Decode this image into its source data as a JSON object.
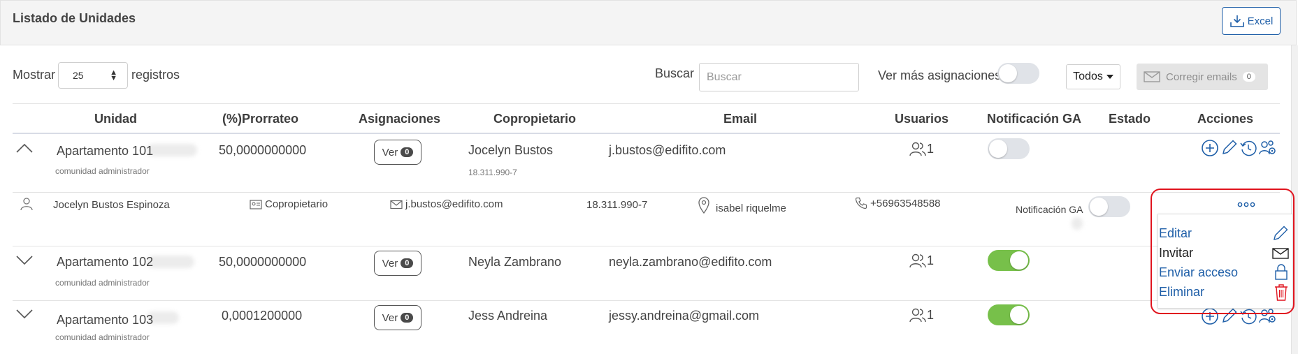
{
  "header": {
    "title": "Listado de Unidades",
    "excel_label": "Excel"
  },
  "controls": {
    "show_label": "Mostrar",
    "page_size": "25",
    "records_label": "registros",
    "search_label": "Buscar",
    "search_placeholder": "Buscar",
    "more_assign_label": "Ver más asignaciones",
    "filter_label": "Todos",
    "fix_emails_label": "Corregir emails",
    "fix_emails_count": "0"
  },
  "table": {
    "columns": [
      "Unidad",
      "(%)Prorrateo",
      "Asignaciones",
      "Copropietario",
      "Email",
      "Usuarios",
      "Notificación GA",
      "Estado",
      "Acciones"
    ],
    "rows": [
      {
        "unit": "Apartamento 101",
        "unit_sub": "comunidad administrador",
        "prorrateo": "50,0000000000",
        "ver_label": "Ver",
        "ver_count": "0",
        "owner": "Jocelyn Bustos",
        "owner_rut": "18.311.990-7",
        "email": "j.bustos@edifito.com",
        "users": "1",
        "notif_on": false
      },
      {
        "unit": "Apartamento 102",
        "unit_sub": "comunidad administrador",
        "prorrateo": "50,0000000000",
        "ver_label": "Ver",
        "ver_count": "0",
        "owner": "Neyla Zambrano",
        "owner_rut": "",
        "email": "neyla.zambrano@edifito.com",
        "users": "1",
        "notif_on": true
      },
      {
        "unit": "Apartamento 103",
        "unit_sub": "comunidad administrador",
        "prorrateo": "0,0001200000",
        "ver_label": "Ver",
        "ver_count": "0",
        "owner": "Jess Andreina",
        "owner_rut": "",
        "email": "jessy.andreina@gmail.com",
        "users": "1",
        "notif_on": true
      }
    ],
    "detail": {
      "name": "Jocelyn Bustos Espinoza",
      "role": "Copropietario",
      "email": "j.bustos@edifito.com",
      "rut": "18.311.990-7",
      "address": "isabel riquelme",
      "phone": "+56963548588",
      "notif_label": "Notificación GA",
      "notif_on": false
    }
  },
  "dropdown_menu": {
    "items": [
      {
        "label": "Editar",
        "icon": "pencil-icon"
      },
      {
        "label": "Invitar",
        "icon": "envelope-icon"
      },
      {
        "label": "Enviar acceso",
        "icon": "lock-icon"
      },
      {
        "label": "Eliminar",
        "icon": "trash-icon"
      }
    ]
  },
  "colors": {
    "link_blue": "#1f5fa8",
    "toggle_green": "#77c04a",
    "danger_red": "#e0141e"
  }
}
